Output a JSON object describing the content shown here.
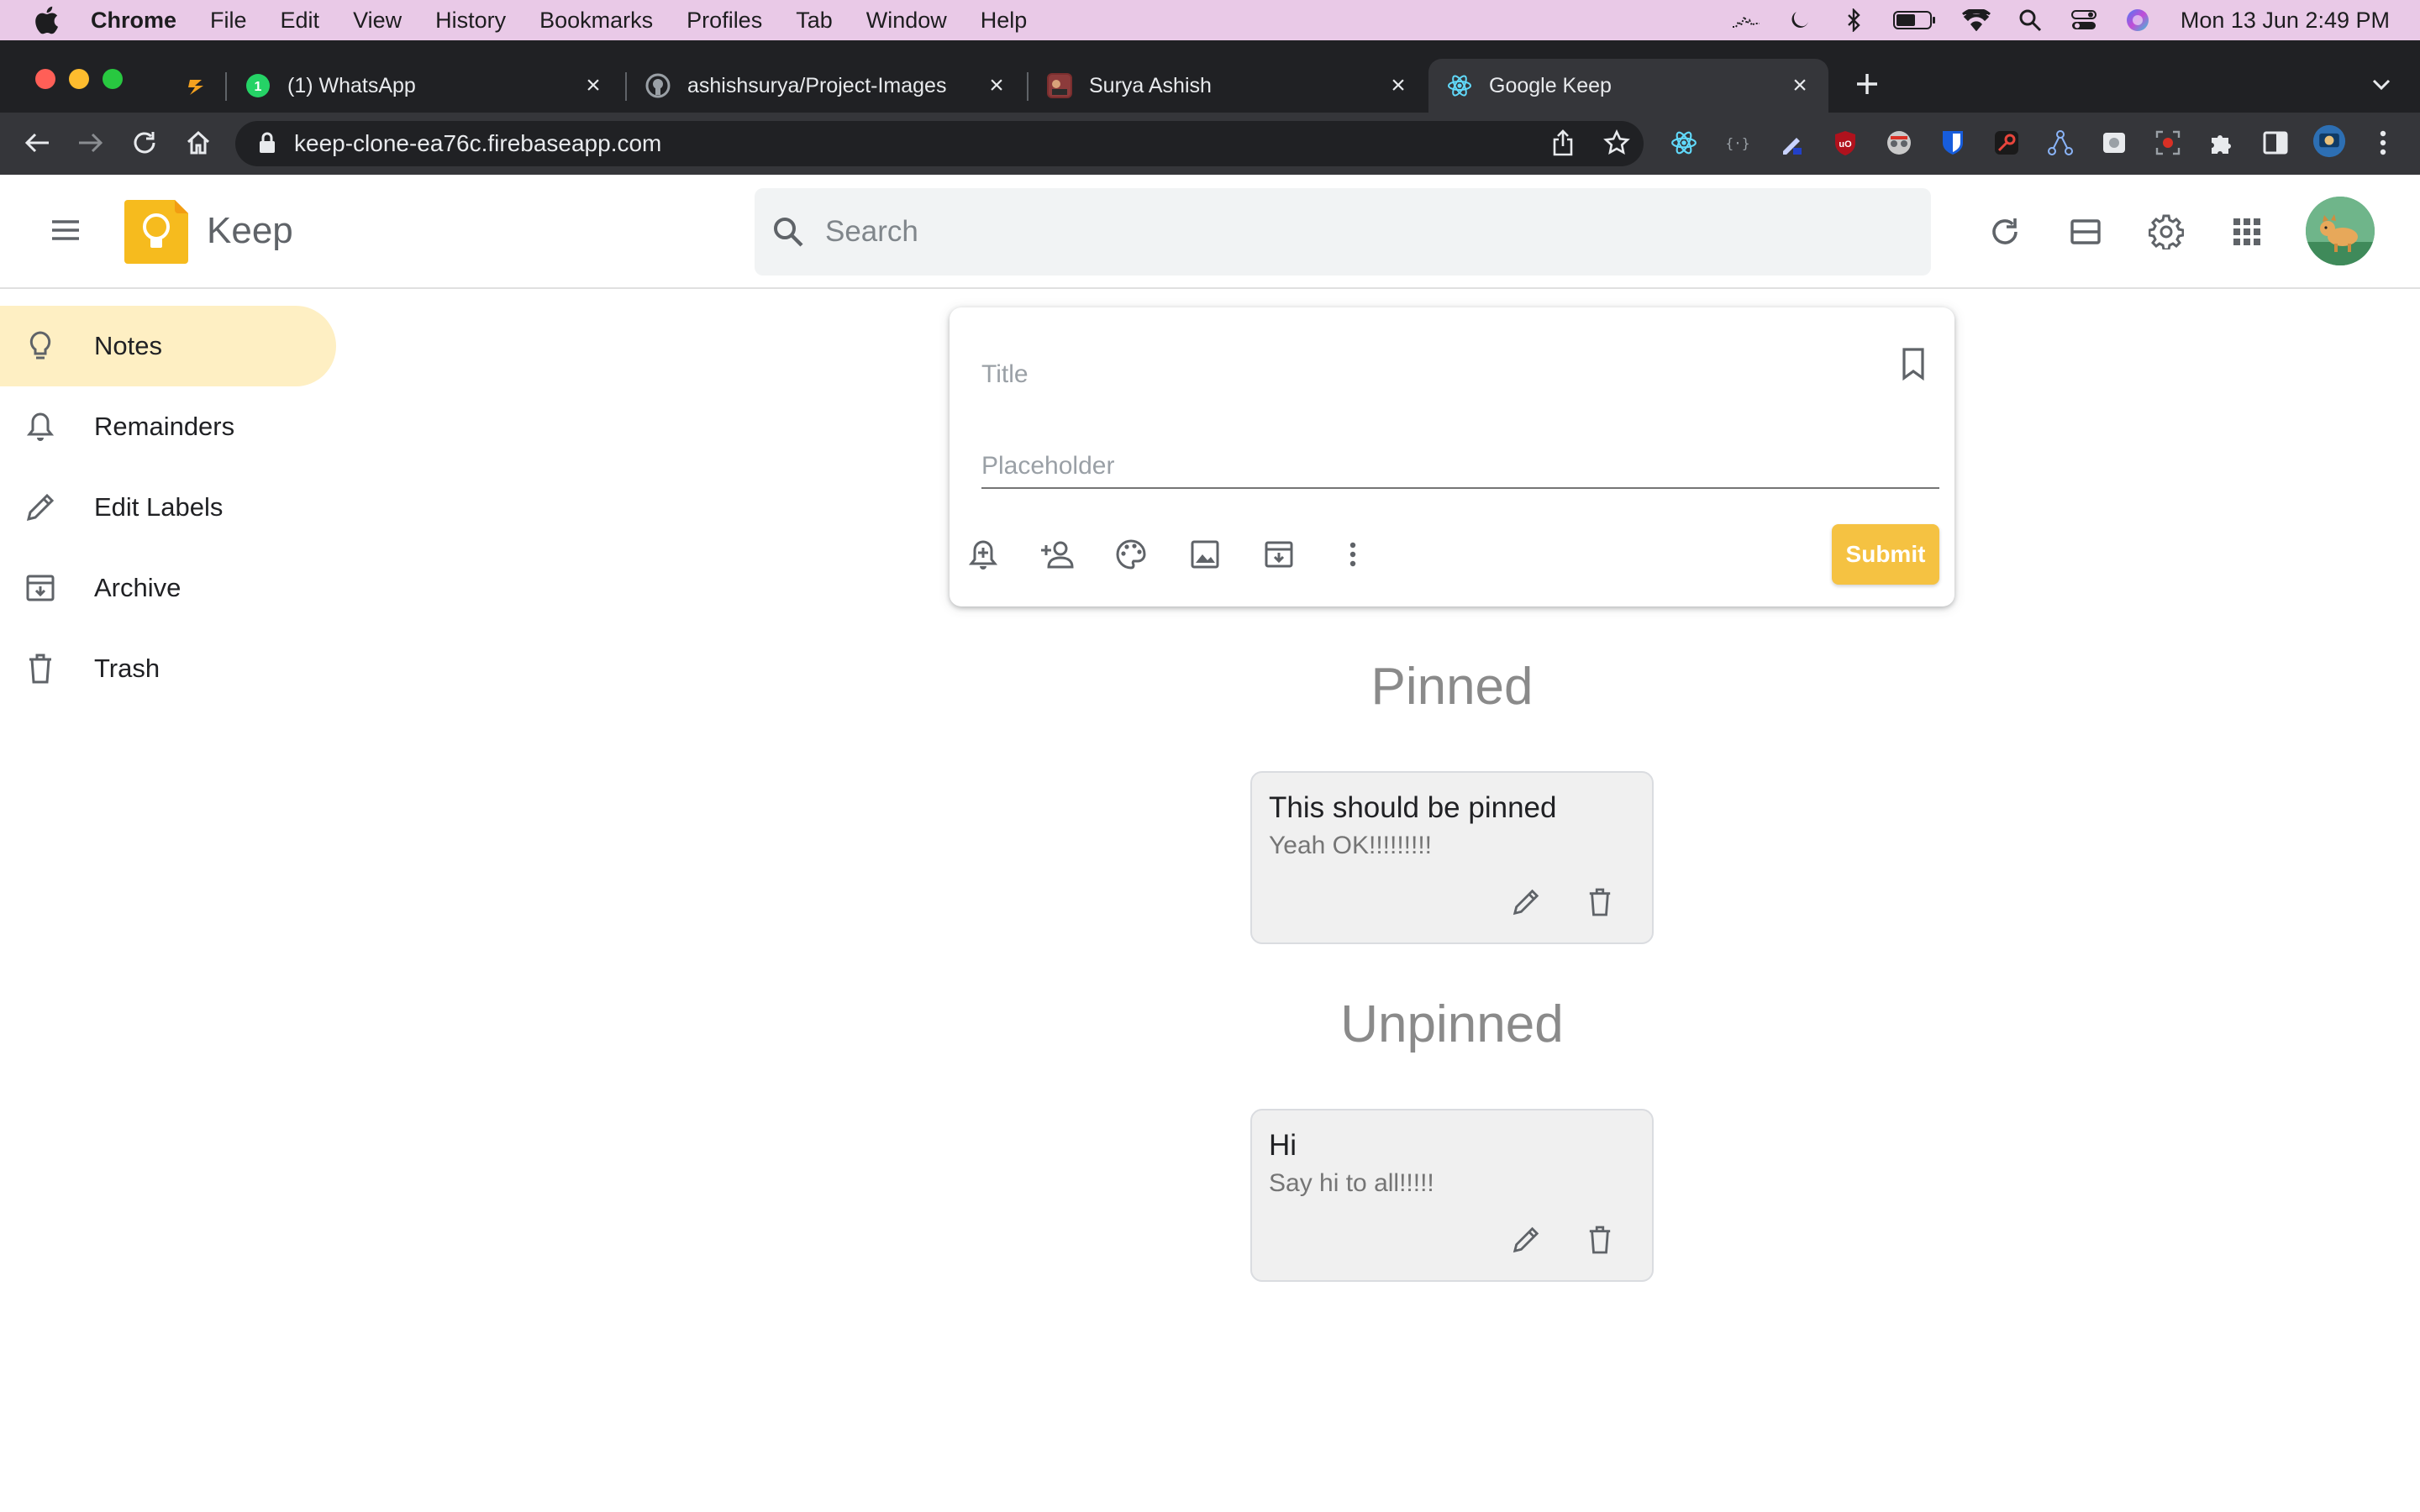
{
  "menubar": {
    "app_name": "Chrome",
    "items": [
      "File",
      "Edit",
      "View",
      "History",
      "Bookmarks",
      "Profiles",
      "Tab",
      "Window",
      "Help"
    ],
    "clock": "Mon 13 Jun  2:49 PM"
  },
  "tabs": [
    {
      "title": "",
      "favicon": "lightning-icon"
    },
    {
      "title": "(1) WhatsApp",
      "favicon": "whatsapp-icon"
    },
    {
      "title": "ashishsurya/Project-Images",
      "favicon": "github-icon"
    },
    {
      "title": "Surya Ashish",
      "favicon": "portfolio-icon"
    },
    {
      "title": "Google Keep",
      "favicon": "react-icon",
      "active": true
    }
  ],
  "address_bar": {
    "url": "keep-clone-ea76c.firebaseapp.com"
  },
  "keep": {
    "brand": "Keep",
    "search_placeholder": "Search",
    "sidebar": [
      {
        "label": "Notes",
        "icon": "bulb-icon",
        "active": true
      },
      {
        "label": "Remainders",
        "icon": "bell-icon"
      },
      {
        "label": "Edit Labels",
        "icon": "pencil-icon"
      },
      {
        "label": "Archive",
        "icon": "archive-icon"
      },
      {
        "label": "Trash",
        "icon": "trash-icon"
      }
    ],
    "composer": {
      "title_placeholder": "Title",
      "body_placeholder": "Placeholder",
      "submit_label": "Submit"
    },
    "pinned_heading": "Pinned",
    "unpinned_heading": "Unpinned",
    "pinned_notes": [
      {
        "title": "This should be pinned",
        "body": "Yeah OK!!!!!!!!!"
      }
    ],
    "unpinned_notes": [
      {
        "title": "Hi",
        "body": "Say hi to all!!!!!"
      }
    ]
  },
  "colors": {
    "accent": "#f5c242",
    "active_nav": "#feefc3",
    "menubar": "#e9c9e7",
    "tabstrip": "#202124",
    "toolbar": "#35363a"
  }
}
